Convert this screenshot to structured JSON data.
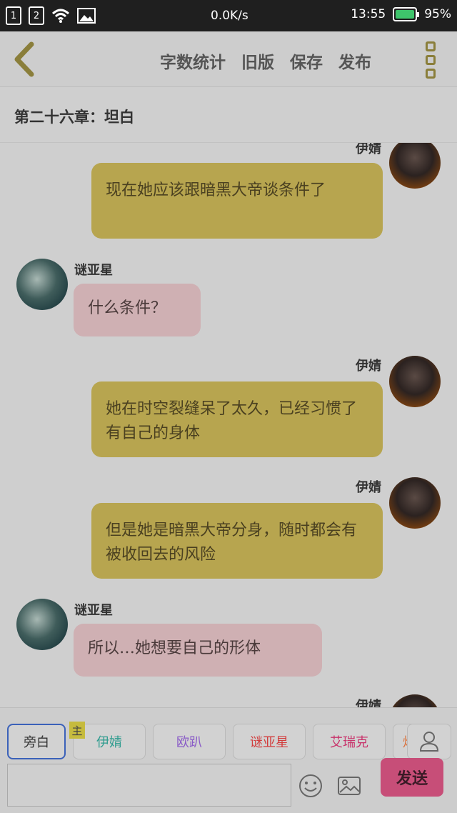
{
  "status_bar": {
    "sim1": "1",
    "sim2": "2",
    "speed": "0.0K/s",
    "time": "13:55",
    "battery": "95%"
  },
  "toolbar": {
    "actions": [
      "字数统计",
      "旧版",
      "保存",
      "发布"
    ]
  },
  "chapter": {
    "title": "第二十六章：坦白"
  },
  "messages": [
    {
      "name": "伊婧",
      "text": "现在她应该跟暗黑大帝谈条件了"
    },
    {
      "name": "谜亚星",
      "text": "什么条件？"
    },
    {
      "name": "伊婧",
      "text": "她在时空裂缝呆了太久，已经习惯了有自己的身体"
    },
    {
      "name": "伊婧",
      "text": "但是她是暗黑大帝分身，随时都会有被收回去的风险"
    },
    {
      "name": "谜亚星",
      "text": "所以…她想要自己的形体"
    },
    {
      "name": "伊婧",
      "text": ""
    }
  ],
  "roles": {
    "selected": "旁白",
    "main_badge": "主",
    "items": [
      {
        "label": "伊婧",
        "color": "#2f9c8f"
      },
      {
        "label": "欧趴",
        "color": "#8a5cc7"
      },
      {
        "label": "谜亚星",
        "color": "#d23c3c"
      },
      {
        "label": "艾瑞克",
        "color": "#c8336b"
      },
      {
        "label": "焰王",
        "color": "#d9703a"
      }
    ]
  },
  "composer": {
    "input_value": "",
    "send_label": "发送"
  },
  "colors": {
    "bubble_self": "#b7a54f",
    "bubble_other": "#cfb0b3",
    "send_button": "#c74e78",
    "selected_border": "#3b61b9"
  }
}
